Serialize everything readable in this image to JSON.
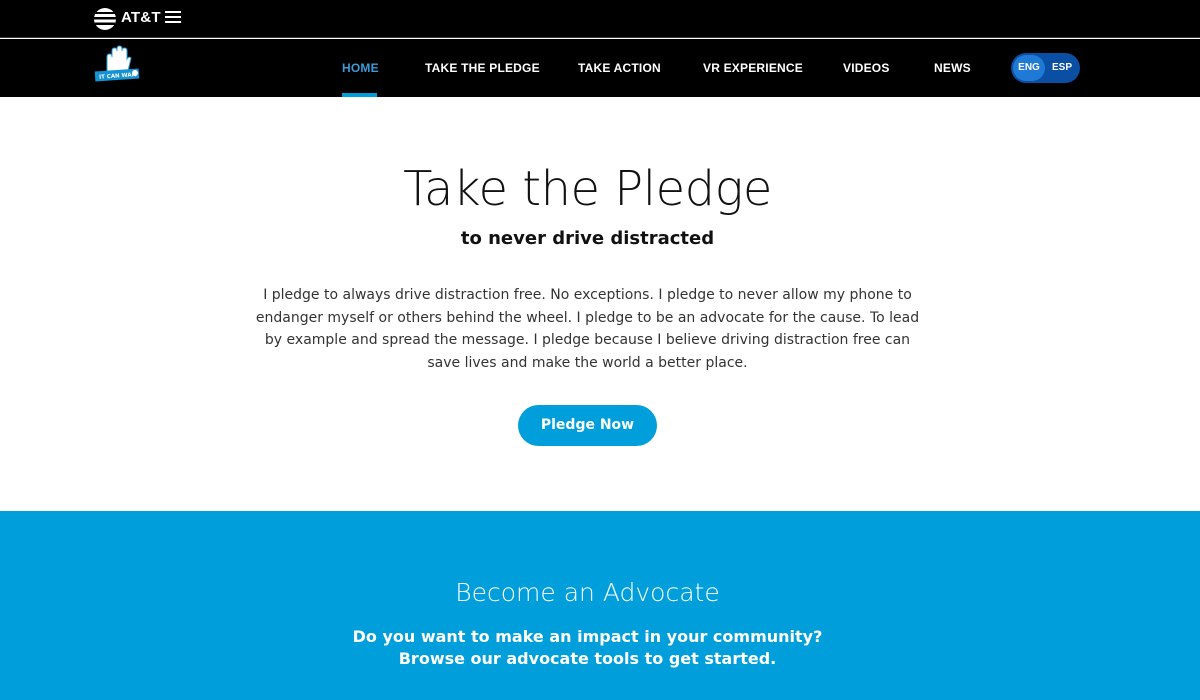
{
  "header": {
    "brand": "AT&T",
    "logo_icon": "att-globe-icon",
    "menu_icon": "hamburger-menu-icon"
  },
  "nav": {
    "logo_icon": "it-can-wait-logo",
    "items": [
      {
        "label": "HOME",
        "active": true
      },
      {
        "label": "TAKE THE PLEDGE",
        "active": false
      },
      {
        "label": "TAKE ACTION",
        "active": false
      },
      {
        "label": "VR EXPERIENCE",
        "active": false
      },
      {
        "label": "VIDEOS",
        "active": false
      },
      {
        "label": "NEWS",
        "active": false
      }
    ],
    "languages": {
      "eng": "ENG",
      "esp": "ESP",
      "selected": "ENG"
    }
  },
  "pledge": {
    "title": "Take the Pledge",
    "subtitle": "to never drive distracted",
    "text": "I pledge to always drive distraction free. No exceptions. I pledge to never allow my phone to endanger myself or others behind the wheel. I pledge to be an advocate for the cause. To lead by example and spread the message. I pledge because I believe driving distraction free can save lives and make the world a better place.",
    "button": "Pledge Now"
  },
  "advocate": {
    "title": "Become an Advocate",
    "line1": "Do you want to make an impact in your community?",
    "line2": "Browse our advocate tools to get started."
  },
  "colors": {
    "accent": "#009fdb",
    "active_nav": "#3b9ad9",
    "lang_toggle": "#0a4fa3",
    "header_bg": "#000000"
  }
}
